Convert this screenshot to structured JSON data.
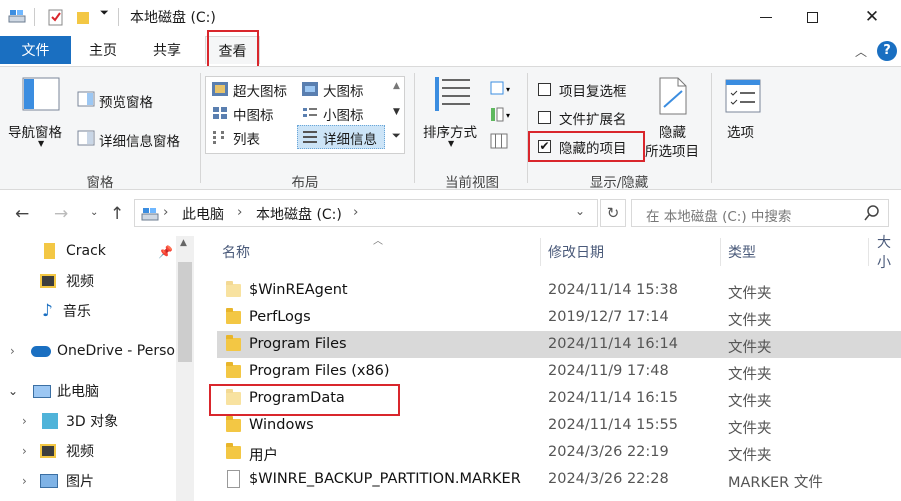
{
  "window": {
    "title": "本地磁盘 (C:)",
    "minimize": "—",
    "maximize": "☐",
    "close": "✕"
  },
  "ribbon_tabs": {
    "file": "文件",
    "home": "主页",
    "share": "共享",
    "view": "查看"
  },
  "ribbon": {
    "panes": {
      "nav_pane": "导航窗格",
      "preview_pane": "预览窗格",
      "details_pane": "详细信息窗格",
      "label": "窗格"
    },
    "layout": {
      "xl_icons": "超大图标",
      "large_icons": "大图标",
      "medium_icons": "中图标",
      "small_icons": "小图标",
      "list": "列表",
      "details": "详细信息",
      "label": "布局"
    },
    "current_view": {
      "sort_by": "排序方式",
      "label": "当前视图"
    },
    "show_hide": {
      "item_checkboxes": "项目复选框",
      "item_checkboxes_checked": false,
      "file_extensions": "文件扩展名",
      "file_extensions_checked": false,
      "hidden_items": "隐藏的项目",
      "hidden_items_checked": true,
      "hide_selected_1": "隐藏",
      "hide_selected_2": "所选项目",
      "label": "显示/隐藏"
    },
    "options": "选项"
  },
  "address": {
    "crumbs": [
      "此电脑",
      "本地磁盘 (C:)"
    ],
    "separator": "›",
    "search_placeholder": "在 本地磁盘 (C:) 中搜索"
  },
  "nav_pane": {
    "items": [
      {
        "label": "Crack",
        "icon": "folder-icon",
        "pinned": true
      },
      {
        "label": "视频",
        "icon": "video-folder-icon"
      },
      {
        "label": "音乐",
        "icon": "music-icon"
      },
      {
        "label": "OneDrive - Perso",
        "icon": "cloud-icon"
      },
      {
        "label": "此电脑",
        "icon": "computer-icon"
      },
      {
        "label": "3D 对象",
        "icon": "cube-icon"
      },
      {
        "label": "视频",
        "icon": "video-folder-icon"
      },
      {
        "label": "图片",
        "icon": "picture-icon"
      }
    ]
  },
  "columns": {
    "name": "名称",
    "date": "修改日期",
    "type": "类型",
    "size": "大小"
  },
  "files": [
    {
      "name": "$WinREAgent",
      "date": "2024/11/14 15:38",
      "type": "文件夹",
      "hidden": true
    },
    {
      "name": "PerfLogs",
      "date": "2019/12/7 17:14",
      "type": "文件夹",
      "hidden": false
    },
    {
      "name": "Program Files",
      "date": "2024/11/14 16:14",
      "type": "文件夹",
      "hidden": false,
      "selected": true
    },
    {
      "name": "Program Files (x86)",
      "date": "2024/11/9 17:48",
      "type": "文件夹",
      "hidden": false
    },
    {
      "name": "ProgramData",
      "date": "2024/11/14 16:15",
      "type": "文件夹",
      "hidden": true
    },
    {
      "name": "Windows",
      "date": "2024/11/14 15:55",
      "type": "文件夹",
      "hidden": false
    },
    {
      "name": "用户",
      "date": "2024/3/26 22:19",
      "type": "文件夹",
      "hidden": false
    },
    {
      "name": "$WINRE_BACKUP_PARTITION.MARKER",
      "date": "2024/3/26 22:28",
      "type": "MARKER 文件",
      "hidden": false,
      "file": true
    }
  ],
  "colors": {
    "accent": "#1a6fc1",
    "highlight_box": "#d9262c",
    "selection": "#d9d9d9",
    "folder": "#f3c744"
  }
}
